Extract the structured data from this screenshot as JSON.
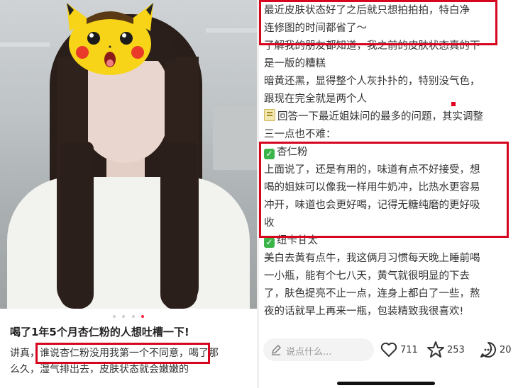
{
  "left": {
    "post_title": "喝了1年5个月杏仁粉的人想吐槽一下!",
    "body_lines": [
      "讲真，谁说杏仁粉没用我第一个不同意，喝了那",
      "么久，湿气排出去，皮肤状态就会嫩嫩的"
    ],
    "carousel": {
      "total": 4,
      "active_index": 3
    },
    "avatar_sticker": "pikachu-face-sticker"
  },
  "right": {
    "paragraphs": [
      "最近皮肤状态好了之后就只想拍拍拍，特白净",
      "连修图的时间都省了～",
      "了解我的朋友都知道，我之前的皮肤状态真的下",
      "是一版的糟糕",
      "暗黄还黑，显得整个人灰扑扑的，特别没气色，",
      "跟现在完全就是两个人",
      "回答一下最近姐妹问的最多的问题，其实调整",
      "三一点也不难：",
      "杏仁粉",
      "上面说了，还是有用的，味道有点不好接受，想",
      "喝的姐妹可以像我一样用牛奶冲，比热水更容易",
      "冲开，味道也会更好喝，记得无糖纯磨的更好吸",
      "收",
      "纽卡甘太",
      "美白去黄有点牛，我这俩月习惯每天晚上睡前喝",
      "一小瓶，能有个七八天，黄气就很明显的下去",
      "了，肤色提亮不止一点，连身上都白了一些，熬",
      "夜的话就早上再来一瓶，包装精致我很喜欢!"
    ],
    "check_mark": "✓",
    "comment_placeholder": "说点什么...",
    "likes": "711",
    "collects": "253",
    "comments": "20"
  },
  "colors": {
    "highlight": "#d6061f",
    "accent": "#ff2442",
    "check": "#3bb54a"
  },
  "icons": [
    "pencil-icon",
    "heart-icon",
    "star-icon",
    "comment-icon",
    "checkmark-icon",
    "memo-icon"
  ]
}
